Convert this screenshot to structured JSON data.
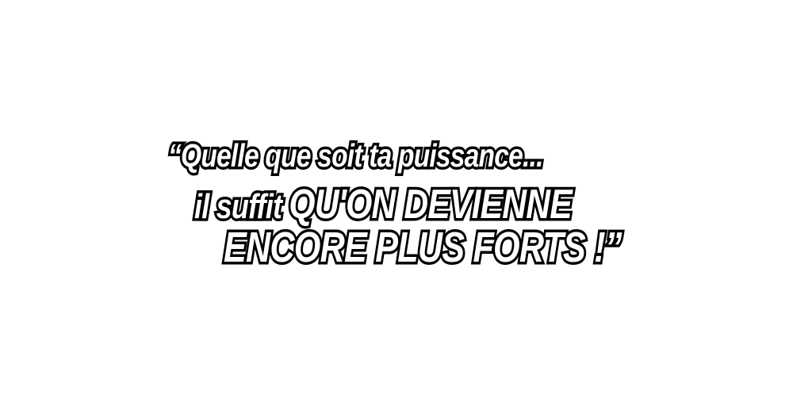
{
  "quote": {
    "line1": "“Quelle que soit ta puissance...",
    "line2_lead": "il suffit ",
    "line2_emphasis": "QU'ON DEVIENNE",
    "line3": "ENCORE PLUS FORTS !”"
  }
}
